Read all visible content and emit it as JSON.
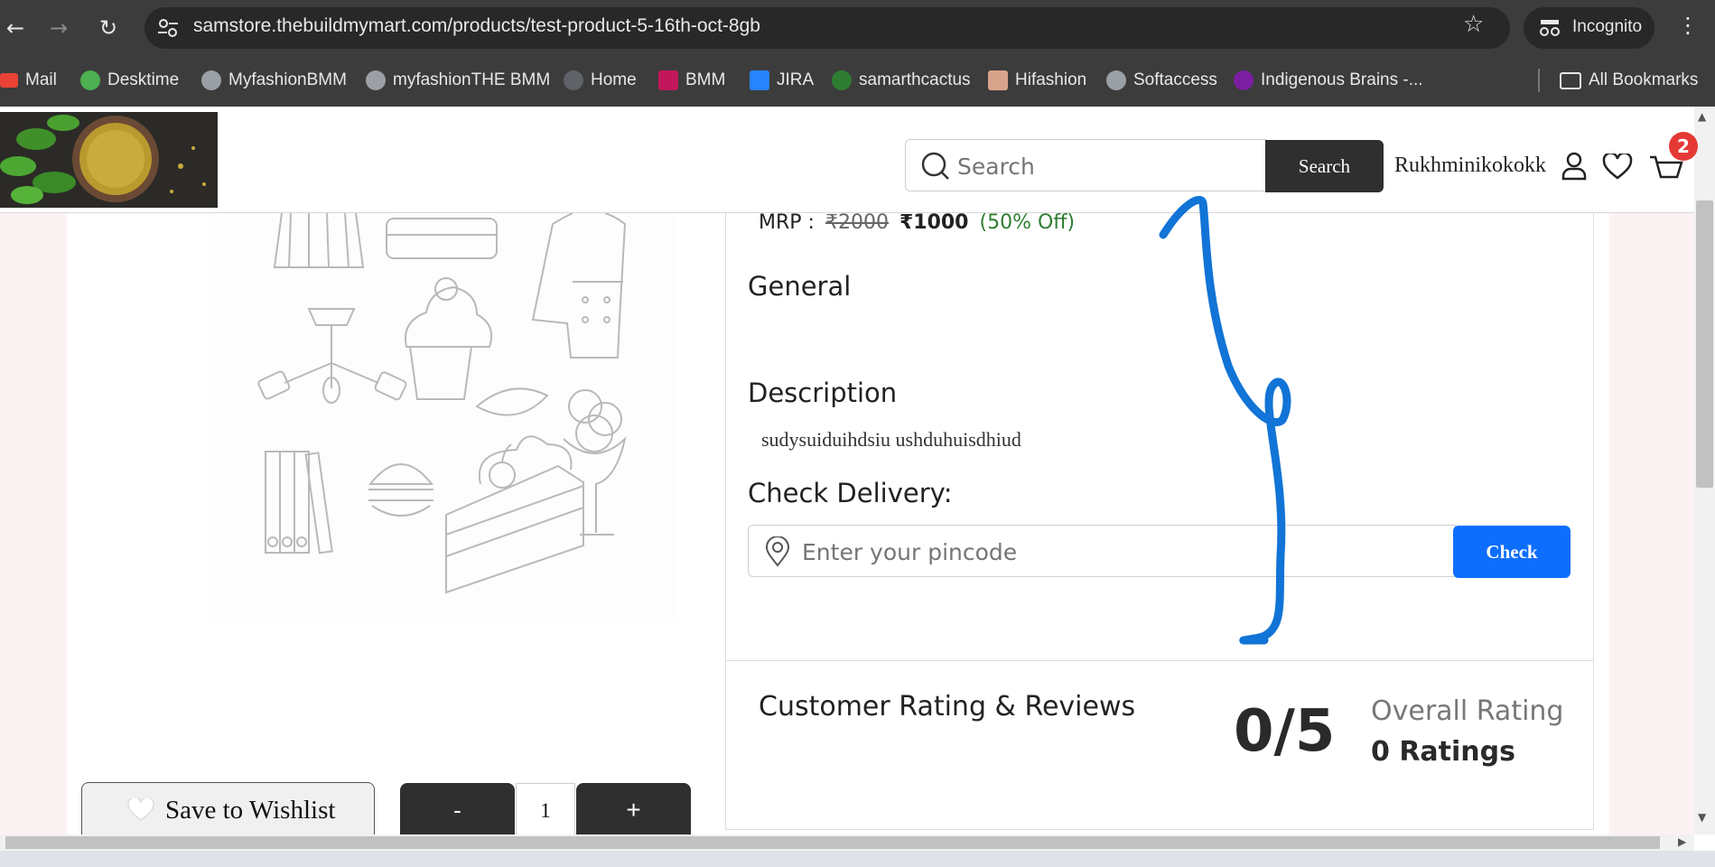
{
  "browser": {
    "url": "samstore.thebuildmymart.com/products/test-product-5-16th-oct-8gb",
    "incognito_label": "Incognito",
    "bookmarks": [
      {
        "label": "Mail",
        "icon": "gmail-icon",
        "color": "#ea4335"
      },
      {
        "label": "Desktime",
        "icon": "desktime-icon",
        "color": "#4caf50"
      },
      {
        "label": "MyfashionBMM",
        "icon": "globe-icon",
        "color": "#9aa0a6"
      },
      {
        "label": "myfashionTHE BMM",
        "icon": "globe-icon",
        "color": "#9aa0a6"
      },
      {
        "label": "Home",
        "icon": "globe-icon",
        "color": "#5f6368"
      },
      {
        "label": "BMM",
        "icon": "bmm-icon",
        "color": "#c2185b"
      },
      {
        "label": "JIRA",
        "icon": "jira-icon",
        "color": "#2684ff"
      },
      {
        "label": "samarthcactus",
        "icon": "cactus-icon",
        "color": "#2e7d32"
      },
      {
        "label": "Hifashion",
        "icon": "hifashion-icon",
        "color": "#d7a38a"
      },
      {
        "label": "Softaccess",
        "icon": "globe-icon",
        "color": "#9aa0a6"
      },
      {
        "label": "Indigenous Brains -...",
        "icon": "indigenous-icon",
        "color": "#7b1fa2"
      },
      {
        "label": "All Bookmarks",
        "icon": "folder-icon",
        "color": "#e8e8e8"
      }
    ]
  },
  "header": {
    "search_placeholder": "Search",
    "search_button": "Search",
    "username": "Rukhminikokokk",
    "cart_count": "2"
  },
  "product": {
    "mrp_label": "MRP :",
    "mrp_old": "₹2000",
    "mrp_new": "₹1000",
    "discount": "(50% Off)",
    "general_heading": "General",
    "description_heading": "Description",
    "description_text": "sudysuiduihdsiu ushduhuisdhiud",
    "check_delivery_heading": "Check Delivery:",
    "pincode_placeholder": "Enter your pincode",
    "check_button": "Check"
  },
  "reviews": {
    "heading": "Customer Rating & Reviews",
    "score": "0/5",
    "overall_label": "Overall Rating",
    "ratings_count": "0 Ratings"
  },
  "actions": {
    "wishlist": "Save to Wishlist",
    "minus": "-",
    "quantity": "1",
    "plus": "+"
  },
  "colors": {
    "accent_blue": "#0d6efd",
    "dark_button": "#2f2f2f",
    "discount_green": "#2e7d32",
    "cart_badge": "#e53935",
    "annotation_stroke": "#1174d6"
  }
}
